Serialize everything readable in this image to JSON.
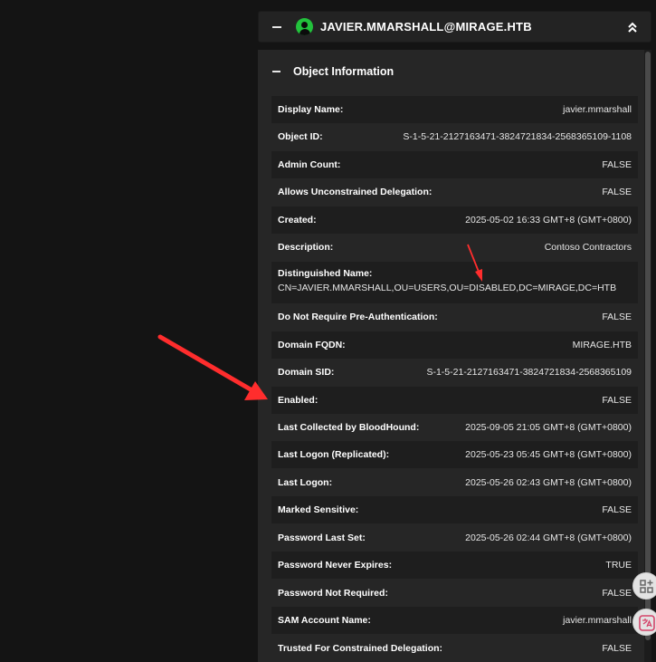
{
  "header": {
    "title": "JAVIER.MMARSHALL@MIRAGE.HTB",
    "collapse_icon": "minus-icon",
    "user_icon": "user-circle-icon",
    "expand_icon": "double-chevron-up-icon",
    "user_icon_color": "#22c23c"
  },
  "section": {
    "title": "Object Information",
    "collapse_icon": "minus-icon"
  },
  "properties": {
    "display_name": {
      "label": "Display Name:",
      "value": "javier.mmarshall"
    },
    "object_id": {
      "label": "Object ID:",
      "value": "S-1-5-21-2127163471-3824721834-2568365109-1108"
    },
    "admin_count": {
      "label": "Admin Count:",
      "value": "FALSE"
    },
    "unconstrained": {
      "label": "Allows Unconstrained Delegation:",
      "value": "FALSE"
    },
    "created": {
      "label": "Created:",
      "value": "2025-05-02 16:33 GMT+8 (GMT+0800)"
    },
    "description": {
      "label": "Description:",
      "value": "Contoso Contractors"
    },
    "distinguished_name": {
      "label": "Distinguished Name:",
      "value": "CN=JAVIER.MMARSHALL,OU=USERS,OU=DISABLED,DC=MIRAGE,DC=HTB"
    },
    "no_preauth": {
      "label": "Do Not Require Pre-Authentication:",
      "value": "FALSE"
    },
    "domain_fqdn": {
      "label": "Domain FQDN:",
      "value": "MIRAGE.HTB"
    },
    "domain_sid": {
      "label": "Domain SID:",
      "value": "S-1-5-21-2127163471-3824721834-2568365109"
    },
    "enabled": {
      "label": "Enabled:",
      "value": "FALSE"
    },
    "last_collected": {
      "label": "Last Collected by BloodHound:",
      "value": "2025-09-05 21:05 GMT+8 (GMT+0800)"
    },
    "last_logon_repl": {
      "label": "Last Logon (Replicated):",
      "value": "2025-05-23 05:45 GMT+8 (GMT+0800)"
    },
    "last_logon": {
      "label": "Last Logon:",
      "value": "2025-05-26 02:43 GMT+8 (GMT+0800)"
    },
    "marked_sensitive": {
      "label": "Marked Sensitive:",
      "value": "FALSE"
    },
    "pwd_last_set": {
      "label": "Password Last Set:",
      "value": "2025-05-26 02:44 GMT+8 (GMT+0800)"
    },
    "pwd_never_expires": {
      "label": "Password Never Expires:",
      "value": "TRUE"
    },
    "pwd_not_required": {
      "label": "Password Not Required:",
      "value": "FALSE"
    },
    "sam_account": {
      "label": "SAM Account Name:",
      "value": "javier.mmarshall"
    },
    "trusted_constrained": {
      "label": "Trusted For Constrained Delegation:",
      "value": "FALSE"
    }
  },
  "side_buttons": [
    "grid-apps-icon",
    "translate-icon"
  ],
  "annotation_color": "#ff2d2d"
}
